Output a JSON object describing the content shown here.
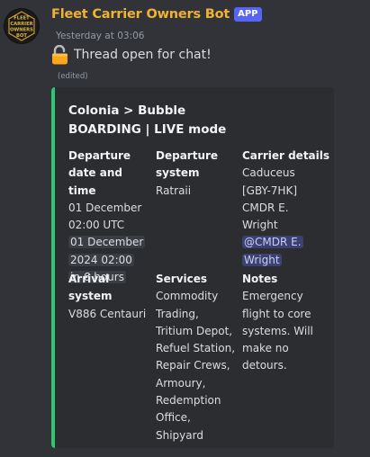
{
  "bot": {
    "username": "Fleet Carrier Owners Bot",
    "badge": "APP",
    "avatar_text": [
      "FLEET",
      "CARRIER",
      "OWNERS",
      "BOT"
    ],
    "timestamp": "Yesterday at 03:06",
    "message": "Thread open for chat!",
    "message_icon": "unlocked-padlock-icon",
    "edited_label": "(edited)"
  },
  "embed": {
    "accent_color": "#2dc770",
    "title_line1": "Colonia > Bubble",
    "title_line2": "BOARDING | LIVE mode",
    "departure_datetime": {
      "name_line1": "Departure",
      "name_line2": "date and time",
      "line1": "01 December",
      "line2": "02:00 UTC",
      "chip_line1": "01 December",
      "chip_line2": "2024 02:00",
      "chip_line3": "in 6 hours"
    },
    "departure_system": {
      "name_line1": "Departure",
      "name_line2": "system",
      "value": "Ratraii"
    },
    "carrier_details": {
      "name": "Carrier details",
      "line1": "Caduceus",
      "line2": "[GBY-7HK]",
      "line3": "CMDR E.",
      "line4": "Wright",
      "mention_line1": "@CMDR E.",
      "mention_line2": "Wright"
    },
    "arrival_system": {
      "name": "Arrival system",
      "value": "V886 Centauri"
    },
    "services": {
      "name": "Services",
      "lines": [
        "Commodity",
        "Trading,",
        "Tritium Depot,",
        "Refuel Station,",
        "Repair Crews,",
        "Armoury,",
        "Redemption",
        "Office,",
        "Shipyard"
      ]
    },
    "notes": {
      "name": "Notes",
      "lines": [
        "Emergency",
        "flight to core",
        "systems. Will",
        "make no",
        "detours."
      ]
    }
  }
}
